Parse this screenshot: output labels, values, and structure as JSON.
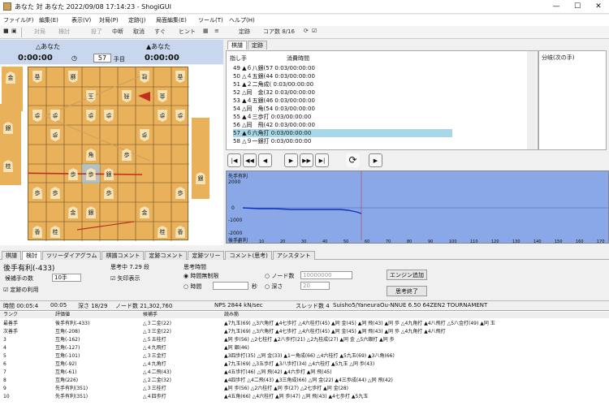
{
  "window": {
    "title": "あなた 対 あなた 2022/09/08 17:14:23 - ShogiGUI"
  },
  "menu": [
    "ファイル(F)",
    "編集(E)",
    "表示(V)",
    "対局(P)",
    "定跡(J)",
    "局面編集(E)",
    "ツール(T)",
    "ヘルプ(H)"
  ],
  "toolbar": {
    "items": [
      "対局",
      "検討",
      "投了",
      "中断",
      "取消",
      "すぐ",
      "ヒント",
      "定跡",
      "コア数 8/16"
    ]
  },
  "players": {
    "black": "△あなた",
    "white": "▲あなた",
    "black_time": "0:00:00",
    "white_time": "0:00:00",
    "move_number": "57",
    "move_suffix": "手目"
  },
  "kifu": {
    "tabs": [
      "棋譜",
      "定跡"
    ],
    "header_move": "指し手",
    "header_time": "消費時間",
    "rows": [
      {
        "n": "49",
        "move": "▲６八銀(57",
        "time": "0:03/00:00:00"
      },
      {
        "n": "50",
        "move": "△４五銀(44",
        "time": "0:03/00:00:00"
      },
      {
        "n": "51",
        "move": "▲２二角成(",
        "time": "0:03/00:00:00"
      },
      {
        "n": "52",
        "move": "△同　金(32",
        "time": "0:03/00:00:00"
      },
      {
        "n": "53",
        "move": "▲４五銀(46",
        "time": "0:03/00:00:00"
      },
      {
        "n": "54",
        "move": "△同　角(54",
        "time": "0:03/00:00:00"
      },
      {
        "n": "55",
        "move": "▲４三歩打",
        "time": "0:03/00:00:00"
      },
      {
        "n": "56",
        "move": "△同　飛(42",
        "time": "0:03/00:00:00"
      },
      {
        "n": "57",
        "move": "▲６六角打",
        "time": "0:03/00:00:00"
      },
      {
        "n": "58",
        "move": "△９一銀打",
        "time": "0:03/00:00:00"
      }
    ]
  },
  "branch": {
    "label": "分岐(次の手)"
  },
  "graph": {
    "title": "先手有利",
    "ylabels": [
      "2000",
      "0",
      "-1000",
      "-2000"
    ],
    "xlabels": [
      "0",
      "10",
      "20",
      "30",
      "40",
      "50",
      "60",
      "70",
      "80",
      "90",
      "100",
      "110",
      "120",
      "130",
      "140",
      "150",
      "160",
      "170"
    ],
    "bottom": "後手有利"
  },
  "lowtabs": [
    "棋譜",
    "検討",
    "ツリーダイアグラム",
    "棋譜コメント",
    "定跡コメント",
    "定跡ツリー",
    "コメント(思考)",
    "アシスタント"
  ],
  "engine": {
    "eval": "後手有利(-433)",
    "thinking": "思考中 7.29 段",
    "think_time_label": "思考時間",
    "unlimited": "時間無制限",
    "time": "時間",
    "sec": "秒",
    "nodes_label": "ノード数",
    "nodes_val": "10000000",
    "depth_label": "深さ",
    "depth_val": "20",
    "pv_count_label": "候補手の数",
    "pv_count": "10手",
    "best_move_label": "矢印表示",
    "joseki_label": "定跡の利用",
    "add_engine": "エンジン追加",
    "stop": "思考終了",
    "status": [
      "時間 00:05:4",
      "00:05",
      "深さ 18/29",
      "ノード数 21,302,760",
      "NPS 2844 kN/sec",
      "スレッド数 4",
      "Suisho5/YaneuraOu-NNUE 6.50 64ZEN2 TOURNAMENT"
    ],
    "cols": [
      "ランク",
      "評価値",
      "候補手",
      "読み筋"
    ],
    "rows": [
      {
        "rank": "最善手",
        "eval": "後手有利(-433)",
        "move": "△３二金(22)",
        "pv": "▲7九玉(69) △3六角打 ▲4七歩打 △4六桂打(45) ▲同 金(45) ▲同 飛(43) ▲同 歩 △4九角打 ▲4八飛打 △5八金打(49) ▲同 玉"
      },
      {
        "rank": "次善手",
        "eval": "互角(-208)",
        "move": "△３三金(22)",
        "pv": "▲7九玉(69) △3六角打 ▲4七歩打 △4六桂打(45) ▲同 金(45) ▲同 飛(43) ▲同 歩 △4九角打 ▲4八飛打"
      },
      {
        "rank": "3",
        "eval": "互角(-162)",
        "move": "△５五桂打",
        "pv": "▲同 歩(56) △2七桂打 ▲2八歩打(21) △2九桂成(27) ▲同 金 △5六銀打 ▲同 歩"
      },
      {
        "rank": "4",
        "eval": "互角(-127)",
        "move": "△４九飛打",
        "pv": "▲同 銀(46)"
      },
      {
        "rank": "5",
        "eval": "互角(-101)",
        "move": "△３三金打",
        "pv": "▲3四歩打(35) △同 金(33) ▲1一角成(66) △4六桂打 ▲5九玉(69) ▲3八角(66)"
      },
      {
        "rank": "6",
        "eval": "互角(-92)",
        "move": "△４九角打",
        "pv": "▲7九玉(69) △3五歩打 ▲3八歩打(34) △4六桂打 ▲5九玉 △同 歩(43)"
      },
      {
        "rank": "7",
        "eval": "互角(-61)",
        "move": "△４二飛(43)",
        "pv": "▲4五歩打(46) △同 飛(42) ▲4六歩打 ▲同 飛(45)"
      },
      {
        "rank": "8",
        "eval": "互角(226)",
        "move": "△２二金(32)",
        "pv": "▲4四歩打 △4二飛(43) ▲3三角成(66) △同 金(22) ▲4三歩成(44) △同 飛(42)"
      },
      {
        "rank": "9",
        "eval": "先手有利(351)",
        "move": "△３三桂打",
        "pv": "▲同 歩(56) △2六桂打 ▲同 歩(27) △2七歩打 ▲同 金(28)"
      },
      {
        "rank": "10",
        "eval": "先手有利(351)",
        "move": "△４四歩打",
        "pv": "▲4五角(66) △4六桂打 ▲同 歩(47) △同 飛(43) ▲4七歩打 ▲5九玉"
      }
    ]
  }
}
